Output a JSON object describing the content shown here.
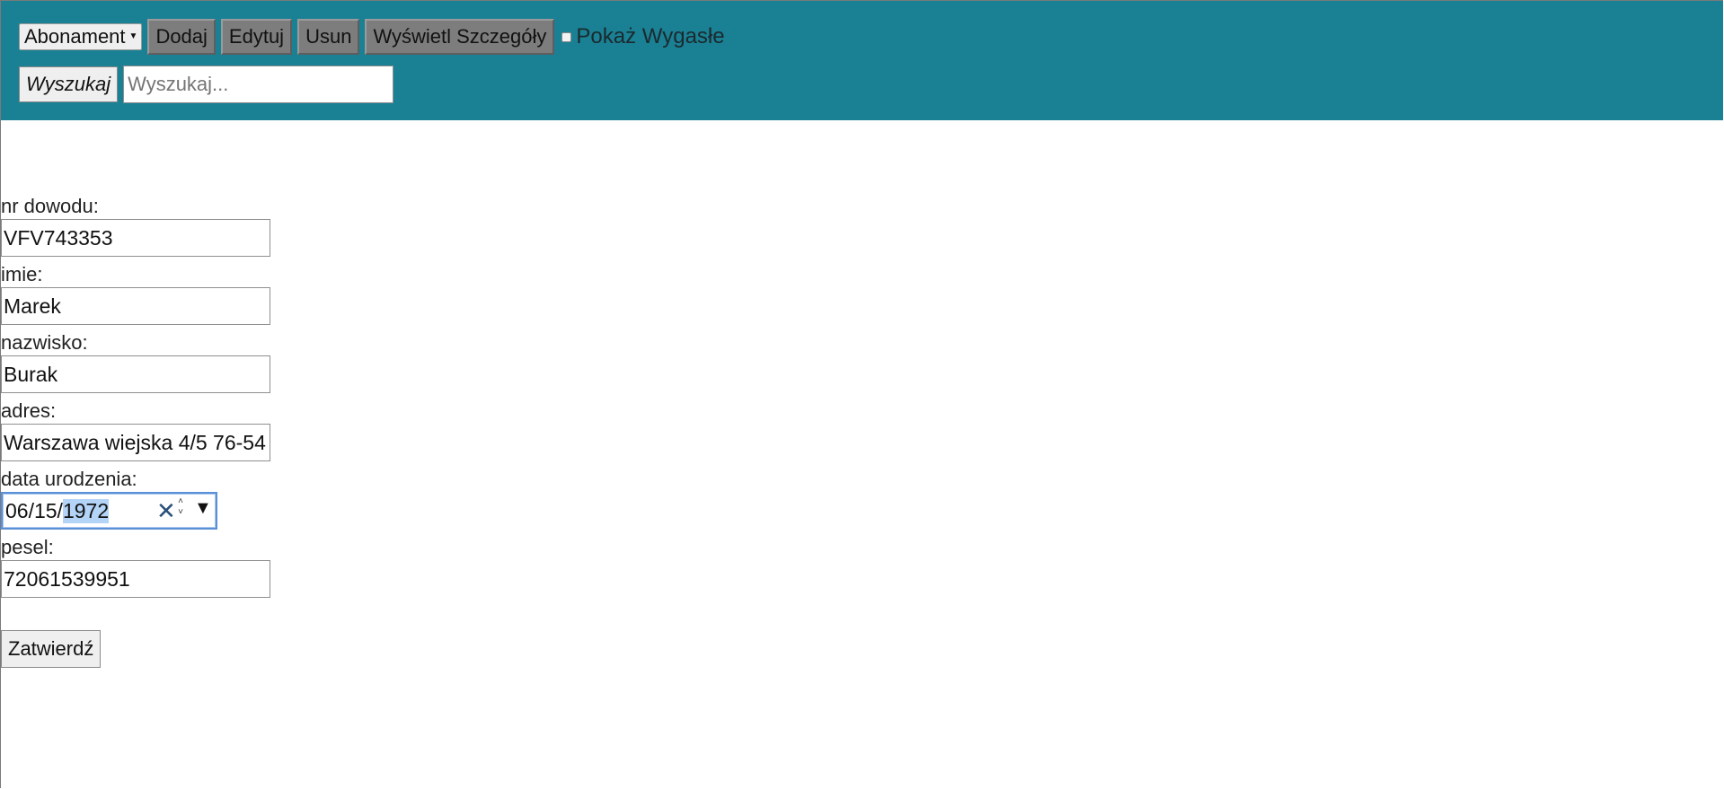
{
  "toolbar": {
    "category_select": "Abonament",
    "add_label": "Dodaj",
    "edit_label": "Edytuj",
    "delete_label": "Usun",
    "details_label": "Wyświetl Szczegóły",
    "show_expired_label": "Pokaż Wygasłe",
    "show_expired_checked": false,
    "search_button": "Wyszukaj",
    "search_placeholder": "Wyszukaj..."
  },
  "form": {
    "id_label": "nr dowodu:",
    "id_value": "VFV743353",
    "first_name_label": "imie:",
    "first_name_value": "Marek",
    "last_name_label": "nazwisko:",
    "last_name_value": "Burak",
    "address_label": "adres:",
    "address_value": "Warszawa wiejska 4/5 76-54",
    "birth_date_label": "data urodzenia:",
    "birth_date_prefix": "06/15/",
    "birth_date_year": "1972",
    "pesel_label": "pesel:",
    "pesel_value": "72061539951",
    "submit_label": "Zatwierdź"
  },
  "colors": {
    "header_bg": "#1a8094",
    "button_bg": "#7d7d7d",
    "focus_border": "#5b8fd6",
    "selection": "#b4d4f7"
  },
  "icons": {
    "select_caret": "caret-down-icon",
    "date_clear": "clear-x-icon",
    "date_spin": "spinner-icon",
    "date_dropdown": "triangle-down-icon"
  }
}
